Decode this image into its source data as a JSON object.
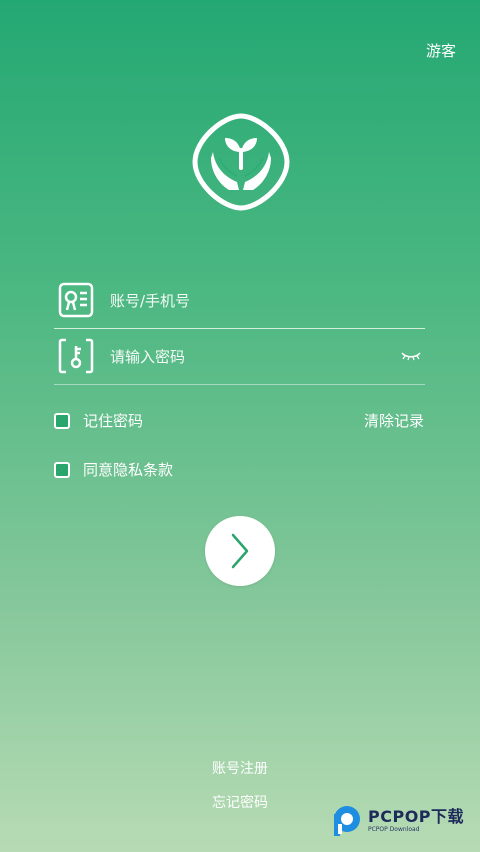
{
  "header": {
    "guest_label": "游客"
  },
  "form": {
    "account_placeholder": "账号/手机号",
    "password_placeholder": "请输入密码",
    "remember_label": "记住密码",
    "clear_label": "清除记录",
    "privacy_label": "同意隐私条款"
  },
  "links": {
    "register_label": "账号注册",
    "forgot_label": "忘记密码"
  },
  "watermark": {
    "brand": "PCPOP下载",
    "sub": "PCPOP Download"
  },
  "colors": {
    "top_green": "#24a873",
    "bottom_green": "#b7dbb4",
    "accent": "#2aa66c"
  },
  "icons": {
    "logo": "sprout-hands-logo",
    "account": "id-card-icon",
    "password": "key-icon",
    "eye": "eye-closed-icon",
    "login": "chevron-right-icon"
  }
}
